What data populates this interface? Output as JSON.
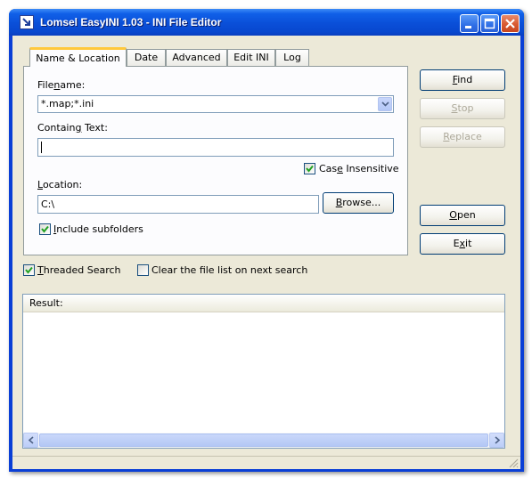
{
  "window": {
    "title": "Lomsel EasyINI 1.03 - INI File Editor"
  },
  "tabs": [
    {
      "label": "Name & Location",
      "active": true
    },
    {
      "label": "Date",
      "active": false
    },
    {
      "label": "Advanced",
      "active": false
    },
    {
      "label": "Edit INI",
      "active": false
    },
    {
      "label": "Log",
      "active": false
    }
  ],
  "filename": {
    "label_pre": "File",
    "label_key": "n",
    "label_post": "ame:",
    "value": "*.map;*.ini"
  },
  "contains": {
    "label_pre": "Contain",
    "label_key": "g",
    "label_post": " Text:",
    "value": ""
  },
  "case_insensitive": {
    "label_pre": "Cas",
    "label_key": "e",
    "label_post": " Insensitive",
    "checked": true
  },
  "location": {
    "label_key": "L",
    "label_post": "ocation:",
    "value": "C:\\"
  },
  "browse": {
    "label_key": "B",
    "label_post": "rowse..."
  },
  "include_subfolders": {
    "label_key": "I",
    "label_post": "nclude subfolders",
    "checked": true
  },
  "buttons": {
    "find": {
      "label_key": "F",
      "label_post": "ind",
      "enabled": true
    },
    "stop": {
      "label_key": "S",
      "label_post": "top",
      "enabled": false
    },
    "replace": {
      "label_key": "R",
      "label_post": "eplace",
      "enabled": false
    },
    "open": {
      "label_key": "O",
      "label_post": "pen",
      "enabled": true
    },
    "exit": {
      "label_pre": "E",
      "label_key": "x",
      "label_post": "it",
      "enabled": true
    }
  },
  "threaded_search": {
    "label_key": "T",
    "label_post": "hreaded Search",
    "checked": true
  },
  "clear_list": {
    "label": "Clear the file list on next search",
    "checked": false
  },
  "result": {
    "header": "Result:"
  },
  "colors": {
    "title_bar": "#0a4fd8",
    "face": "#ece9d8",
    "active_tab_accent": "#ffc83c",
    "close_button": "#d85a32"
  },
  "icons": [
    "app-icon",
    "minimize-icon",
    "maximize-icon",
    "close-icon",
    "dropdown-arrow-icon",
    "checkmark-icon",
    "scroll-left-icon",
    "scroll-right-icon",
    "resize-grip-icon"
  ]
}
